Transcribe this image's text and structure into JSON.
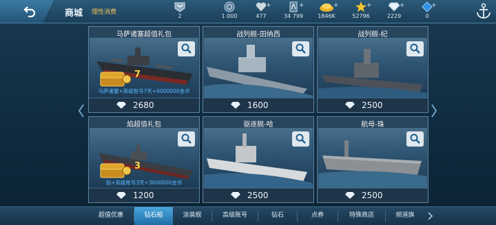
{
  "header": {
    "title": "商城",
    "subtitle": "理性消费"
  },
  "resources": [
    {
      "name": "rank",
      "icon": "rank-badge-icon",
      "value": "2"
    },
    {
      "name": "gold-coin",
      "icon": "coin-icon",
      "value": "1 000"
    },
    {
      "name": "stamina",
      "icon": "heart-icon",
      "value": "477"
    },
    {
      "name": "experience",
      "icon": "experience-icon",
      "value": "34 799"
    },
    {
      "name": "gold",
      "icon": "gold-pile-icon",
      "value": "1846K"
    },
    {
      "name": "star",
      "icon": "star-icon",
      "value": "52796"
    },
    {
      "name": "diamond",
      "icon": "diamond-icon",
      "value": "2229"
    },
    {
      "name": "blue-gem",
      "icon": "blue-gem-icon",
      "value": "0"
    }
  ],
  "cards": [
    {
      "title": "马萨诸塞超值礼包",
      "price": "2680",
      "promo": "马萨诸塞+高级账号7天+6000000金币",
      "chest_number": "7"
    },
    {
      "title": "战列舰-田纳西",
      "price": "1600"
    },
    {
      "title": "战列舰-纪",
      "price": "2500"
    },
    {
      "title": "焰超值礼包",
      "price": "1200",
      "promo": "焰+高级账号3天+3600000金币",
      "chest_number": "3"
    },
    {
      "title": "驱逐舰-哈",
      "price": "2500"
    },
    {
      "title": "航母-珠",
      "price": "2500"
    }
  ],
  "tabs": [
    {
      "label": "超值优惠",
      "active": false
    },
    {
      "label": "钻石船",
      "active": true
    },
    {
      "label": "涂装舰",
      "active": false
    },
    {
      "label": "高级账号",
      "active": false
    },
    {
      "label": "钻石",
      "active": false
    },
    {
      "label": "点券",
      "active": false
    },
    {
      "label": "特殊商店",
      "active": false
    },
    {
      "label": "频道旗",
      "active": false
    }
  ],
  "colors": {
    "accent": "#4aa6dc",
    "price_bg": "#1e3449",
    "promo_text": "#57b8ff",
    "subtitle": "#f1c25a"
  }
}
